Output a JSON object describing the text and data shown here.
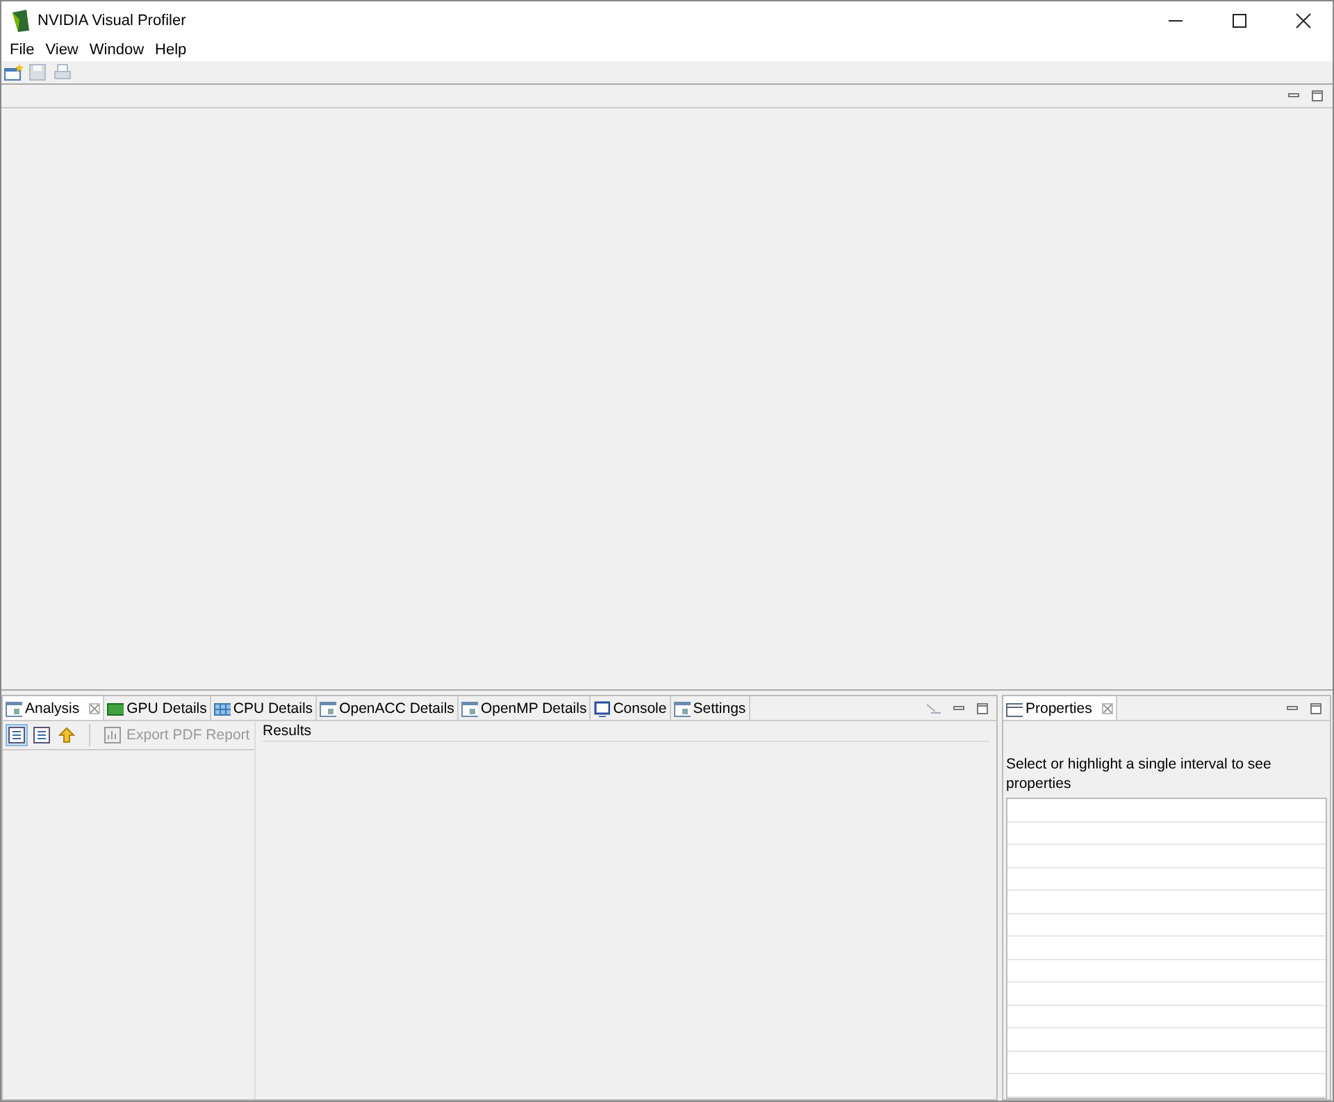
{
  "window": {
    "title": "NVIDIA Visual Profiler"
  },
  "menu": [
    "File",
    "View",
    "Window",
    "Help"
  ],
  "toolbar": [
    {
      "kind": "new",
      "disabled": false
    },
    {
      "kind": "save",
      "disabled": true
    },
    {
      "kind": "print",
      "disabled": true
    }
  ],
  "bottom_left": {
    "tabs": [
      {
        "label": "Analysis",
        "kind": "view",
        "selected": true
      },
      {
        "label": "GPU Details",
        "kind": "gpu",
        "selected": false
      },
      {
        "label": "CPU Details",
        "kind": "cpu",
        "selected": false
      },
      {
        "label": "OpenACC Details",
        "kind": "view",
        "selected": false
      },
      {
        "label": "OpenMP Details",
        "kind": "view",
        "selected": false
      },
      {
        "label": "Console",
        "kind": "console",
        "selected": false
      },
      {
        "label": "Settings",
        "kind": "view",
        "selected": false
      }
    ],
    "view_buttons": [
      {
        "kind": "list",
        "selected": true
      },
      {
        "kind": "list",
        "selected": false
      },
      {
        "kind": "up",
        "selected": false
      }
    ],
    "export_button": {
      "label": "Export PDF Report",
      "disabled": true
    },
    "results_label": "Results"
  },
  "bottom_right": {
    "tabs": [
      {
        "label": "Properties",
        "kind": "props",
        "selected": true
      }
    ],
    "message": "Select or highlight a single interval to see properties"
  }
}
